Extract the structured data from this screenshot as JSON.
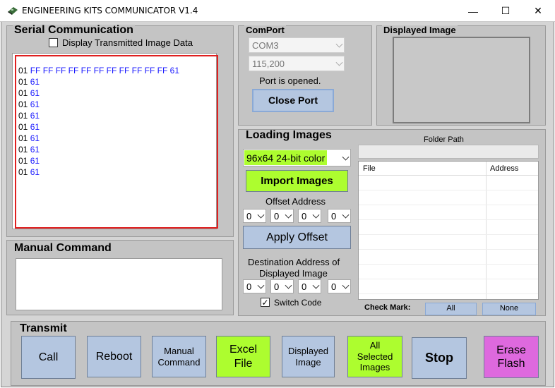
{
  "window": {
    "title": "ENGINEERING KITS COMMUNICATOR V1.4",
    "minimize": "—",
    "maximize": "☐",
    "close": "✕"
  },
  "serial": {
    "title": "Serial Communication",
    "display_checkbox_label": "Display Transmitted Image Data",
    "display_checked": false,
    "lines": [
      {
        "addr": "01",
        "data": "FF FF FF FF FF FF FF FF FF FF FF 61"
      },
      {
        "addr": "01",
        "data": "61"
      },
      {
        "addr": "01",
        "data": "61"
      },
      {
        "addr": "01",
        "data": "61"
      },
      {
        "addr": "01",
        "data": "61"
      },
      {
        "addr": "01",
        "data": "61"
      },
      {
        "addr": "01",
        "data": "61"
      },
      {
        "addr": "01",
        "data": "61"
      },
      {
        "addr": "01",
        "data": "61"
      },
      {
        "addr": "01",
        "data": "61"
      }
    ]
  },
  "manual": {
    "title": "Manual Command",
    "value": ""
  },
  "comport": {
    "title": "ComPort",
    "port": "COM3",
    "baud": "115,200",
    "status": "Port is opened.",
    "close_label": "Close Port"
  },
  "displayed": {
    "title": "Displayed Image"
  },
  "loading": {
    "title": "Loading Images",
    "format": "96x64 24-bit color",
    "import_label": "Import Images",
    "offset_label": "Offset Address",
    "offset_values": [
      "0",
      "0",
      "0",
      "0"
    ],
    "apply_label": "Apply Offset",
    "dest_label_1": "Destination Address of",
    "dest_label_2": "Displayed Image",
    "dest_values": [
      "0",
      "0",
      "0",
      "0"
    ],
    "switch_label": "Switch Code",
    "switch_checked": true,
    "folder_label": "Folder  Path",
    "folder_value": "",
    "col_file": "File",
    "col_address": "Address",
    "check_mark_label": "Check Mark:",
    "all_label": "All",
    "none_label": "None"
  },
  "transmit": {
    "title": "Transmit",
    "call": "Call",
    "reboot": "Reboot",
    "manual_command_1": "Manual",
    "manual_command_2": "Command",
    "excel_1": "Excel",
    "excel_2": "File",
    "displayed_1": "Displayed",
    "displayed_2": "Image",
    "all_1": "All",
    "all_2": "Selected",
    "all_3": "Images",
    "stop": "Stop",
    "erase_1": "Erase",
    "erase_2": "Flash"
  },
  "colors": {
    "green": "#adfd2f",
    "blue": "#b4c6e0",
    "pink": "#de69de",
    "log_border": "#e02020",
    "log_data": "#1a1aff"
  }
}
